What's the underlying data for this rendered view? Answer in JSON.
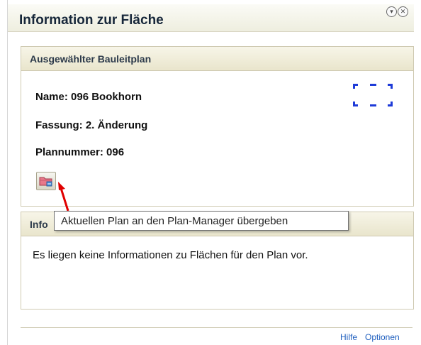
{
  "window": {
    "title": "Information zur Fläche",
    "icons": [
      "collapse-icon",
      "close-icon"
    ]
  },
  "selected_plan_panel": {
    "header": "Ausgewählter Bauleitplan",
    "name": "Name: 096 Bookhorn",
    "version": "Fassung: 2. Änderung",
    "plan_number": "Plannummer: 096",
    "action_icon": "plan-manager-transfer-icon"
  },
  "area_info_panel": {
    "header_visible": "Info",
    "message": "Es liegen keine Informationen zu Flächen für den Plan vor."
  },
  "tooltip": {
    "text": "Aktuellen Plan an den Plan-Manager übergeben"
  },
  "footer": {
    "help_label": "Hilfe",
    "options_label": "Optionen"
  },
  "colors": {
    "selection_frame": "#1e3bd8",
    "link": "#1f5fbf",
    "annotation_arrow": "#e00000"
  }
}
